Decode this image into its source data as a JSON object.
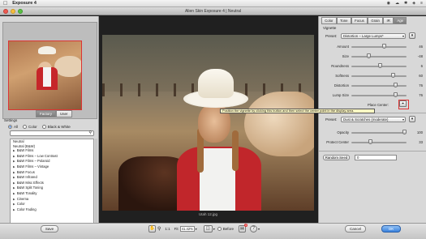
{
  "menubar": {
    "app_name": "Exposure 4",
    "apple": "",
    "status": [
      "◉",
      "☁",
      "✱",
      "◈",
      "≡"
    ]
  },
  "window": {
    "title": "Alien Skin Exposure 4 | Neutral"
  },
  "left_panel": {
    "tabs": [
      "Factory",
      "User"
    ],
    "selected_tab": "Factory",
    "settings_label": "Settings",
    "filters": [
      {
        "label": "All",
        "selected": true
      },
      {
        "label": "Color",
        "selected": false
      },
      {
        "label": "Black & White",
        "selected": false
      }
    ],
    "search": {
      "value": "",
      "icon": "search-icon"
    },
    "presets": [
      {
        "label": "Neutral",
        "expandable": false
      },
      {
        "label": "Neutral (B&W)",
        "expandable": false
      },
      {
        "label": "B&W Films",
        "expandable": true
      },
      {
        "label": "B&W Films – Low Contrast",
        "expandable": true
      },
      {
        "label": "B&W Films – Polaroid",
        "expandable": true
      },
      {
        "label": "B&W Films – Vintage",
        "expandable": true
      },
      {
        "label": "B&W Focus",
        "expandable": true
      },
      {
        "label": "B&W Infrared",
        "expandable": true
      },
      {
        "label": "B&W Misc Effects",
        "expandable": true
      },
      {
        "label": "B&W Split Toning",
        "expandable": true
      },
      {
        "label": "B&W Tonality",
        "expandable": true
      },
      {
        "label": "Cinema",
        "expandable": true
      },
      {
        "label": "Color",
        "expandable": true
      },
      {
        "label": "Color Fading",
        "expandable": true
      }
    ]
  },
  "center": {
    "caption": "Utah 12.jpg"
  },
  "tooltip": {
    "text": "Position the vignette by clicking this button and then select the center point in the display area."
  },
  "right_panel": {
    "tabs": [
      "Color",
      "Tone",
      "Focus",
      "Grain",
      "IR",
      "Age"
    ],
    "selected_tab": "Age",
    "vignette": {
      "label": "Vignette",
      "preset_label": "Preset:",
      "preset_value": "Distortion – Large Lumps*",
      "sliders": [
        {
          "label": "Amount",
          "value": "46",
          "level": 0.6
        },
        {
          "label": "Size",
          "value": "-48",
          "level": 0.3
        },
        {
          "label": "Roundness",
          "value": "6",
          "level": 0.52
        },
        {
          "label": "Softness",
          "value": "60",
          "level": 0.78
        },
        {
          "label": "Distortion",
          "value": "76",
          "level": 0.82
        },
        {
          "label": "Lump Size",
          "value": "76",
          "level": 0.82
        }
      ],
      "place_center_label": "Place Center:",
      "place_center_icon": "crosshair-icon"
    },
    "dust": {
      "preset_label": "Preset:",
      "preset_value": "Dust & Scratches (moderate)",
      "sliders": [
        {
          "label": "Opacity",
          "value": "100",
          "level": 1.0
        },
        {
          "label": "Protect Center",
          "value": "33",
          "level": 0.33
        }
      ],
      "random_seed_label": "Random Seed",
      "seed_value": "0"
    }
  },
  "bottom": {
    "save_label": "Save",
    "cancel_label": "Cancel",
    "ok_label": "OK",
    "zoom_ratio": "1:1",
    "fit_label": "Fit",
    "zoom_value": "41.42%",
    "before_label": "Before",
    "badge_count": "4"
  },
  "colors": {
    "accent_red": "#d33333",
    "ok_blue": "#3a82dd",
    "tooltip_bg": "#fff9c4"
  }
}
